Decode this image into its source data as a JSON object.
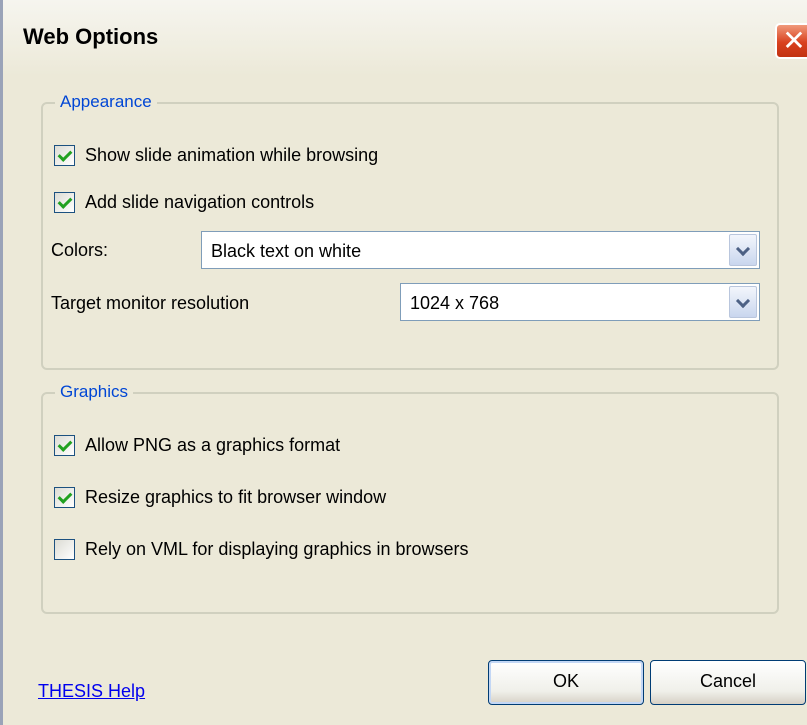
{
  "window": {
    "title": "Web Options",
    "close_glyph": "✕"
  },
  "appearance": {
    "legend": "Appearance",
    "show_animation": {
      "label": "Show slide animation while browsing",
      "checked": true
    },
    "add_navigation": {
      "label": "Add slide navigation controls",
      "checked": true
    },
    "colors": {
      "label": "Colors:",
      "value": "Black text on white"
    },
    "resolution": {
      "label": "Target monitor resolution",
      "value": "1024 x 768"
    }
  },
  "graphics": {
    "legend": "Graphics",
    "allow_png": {
      "label": "Allow PNG as a graphics format",
      "checked": true
    },
    "resize_graphics": {
      "label": "Resize graphics to fit browser window",
      "checked": true
    },
    "rely_vml": {
      "label": "Rely on VML for displaying graphics in browsers",
      "checked": false
    }
  },
  "footer": {
    "help_link": "THESIS Help",
    "ok_label": "OK",
    "cancel_label": "Cancel"
  },
  "colors": {
    "dialog_bg": "#ece9d8",
    "legend_text": "#0046d5",
    "checkmark": "#21a121",
    "close_button": "#d9411f",
    "link": "#0000ee"
  }
}
